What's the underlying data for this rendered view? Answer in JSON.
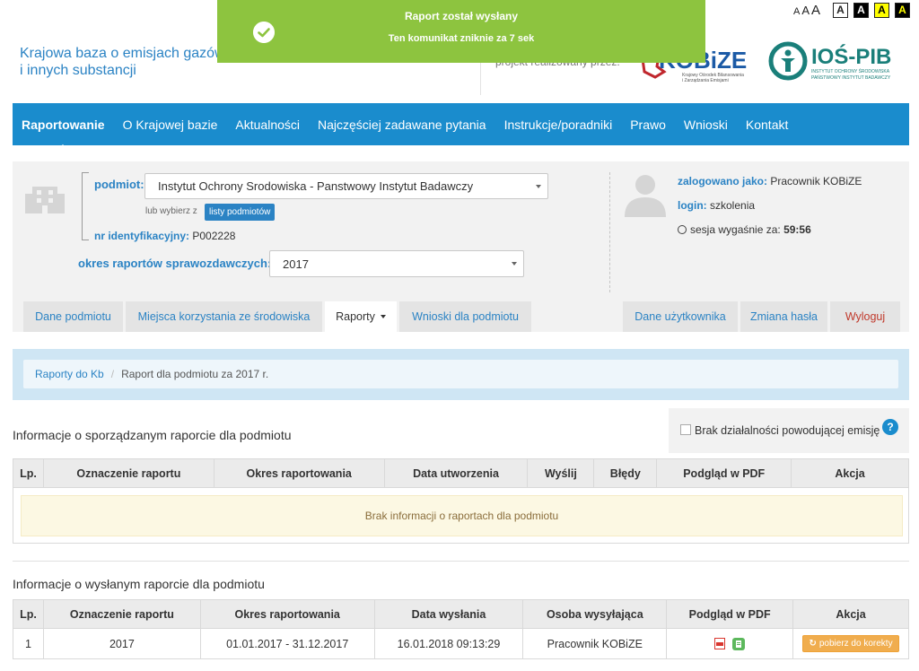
{
  "accessibility": {
    "font_sizes": [
      "A",
      "A",
      "A"
    ],
    "contrast_options": [
      "A",
      "A",
      "A",
      "A"
    ]
  },
  "header": {
    "site_title_line1": "Krajowa baza o emisjach gazów",
    "site_title_line2": "i innych substancji",
    "project_text": "projekt realizowany przez:",
    "logo_kobize_text": "KOBiZE",
    "logo_kobize_sub1": "Krajowy Ośrodek Bilansowania",
    "logo_kobize_sub2": "i Zarządzania Emisjami",
    "logo_ios_text": "IOŚ-PIB",
    "logo_ios_sub1": "INSTYTUT OCHRONY ŚRODOWISKA",
    "logo_ios_sub2": "PAŃSTWOWY INSTYTUT BADAWCZY"
  },
  "toast": {
    "title": "Raport został wysłany",
    "subtitle": "Ten komunikat zniknie za 7 sek",
    "icon": "check-icon",
    "color": "#8dc43f"
  },
  "mainnav": {
    "items": [
      {
        "label": "Raportowanie",
        "active": true
      },
      {
        "label": "O Krajowej bazie"
      },
      {
        "label": "Aktualności"
      },
      {
        "label": "Najczęściej zadawane pytania"
      },
      {
        "label": "Instrukcje/poradniki"
      },
      {
        "label": "Prawo"
      },
      {
        "label": "Wnioski"
      },
      {
        "label": "Kontakt"
      }
    ],
    "color": "#1a8ccd"
  },
  "entity": {
    "podmiot_label": "podmiot:",
    "podmiot_value": "Instytut Ochrony Srodowiska - Panstwowy Instytut Badawczy",
    "lub_text": "lub wybierz z",
    "lista_button": "listy podmiotów",
    "nr_label": "nr identyfikacyjny:",
    "nr_value": "P002228",
    "okres_label": "okres raportów sprawozdawczych:",
    "okres_value": "2017"
  },
  "user": {
    "zalogowano_label": "zalogowano jako:",
    "zalogowano_value": "Pracownik KOBiZE",
    "login_label": "login:",
    "login_value": "szkolenia",
    "sesja_label": "sesja wygaśnie za:",
    "sesja_value": "59:56"
  },
  "tabs": {
    "left": [
      {
        "label": "Dane podmiotu"
      },
      {
        "label": "Miejsca korzystania ze środowiska"
      },
      {
        "label": "Raporty",
        "active": true
      },
      {
        "label": "Wnioski dla podmiotu"
      }
    ],
    "right": [
      {
        "label": "Dane użytkownika"
      },
      {
        "label": "Zmiana hasła"
      },
      {
        "label": "Wyloguj"
      }
    ]
  },
  "breadcrumb": {
    "link": "Raporty do Kb",
    "current": "Raport dla podmiotu za 2017 r."
  },
  "section1": {
    "title": "Informacje o sporządzanym raporcie dla podmiotu",
    "brak_label": "Brak działalności powodującej emisję",
    "help": "?",
    "columns": [
      "Lp.",
      "Oznaczenie raportu",
      "Okres raportowania",
      "Data utworzenia",
      "Wyślij",
      "Błędy",
      "Podgląd w PDF",
      "Akcja"
    ],
    "empty_message": "Brak informacji o raportach dla podmiotu"
  },
  "section2": {
    "title": "Informacje o wysłanym raporcie dla podmiotu",
    "columns": [
      "Lp.",
      "Oznaczenie raportu",
      "Okres raportowania",
      "Data wysłania",
      "Osoba wysyłająca",
      "Podgląd w PDF",
      "Akcja"
    ],
    "rows": [
      {
        "lp": "1",
        "oznaczenie": "2017",
        "okres": "01.01.2017 - 31.12.2017",
        "data": "16.01.2018 09:13:29",
        "osoba": "Pracownik KOBiZE",
        "akcja": "pobierz do korekty"
      }
    ]
  }
}
